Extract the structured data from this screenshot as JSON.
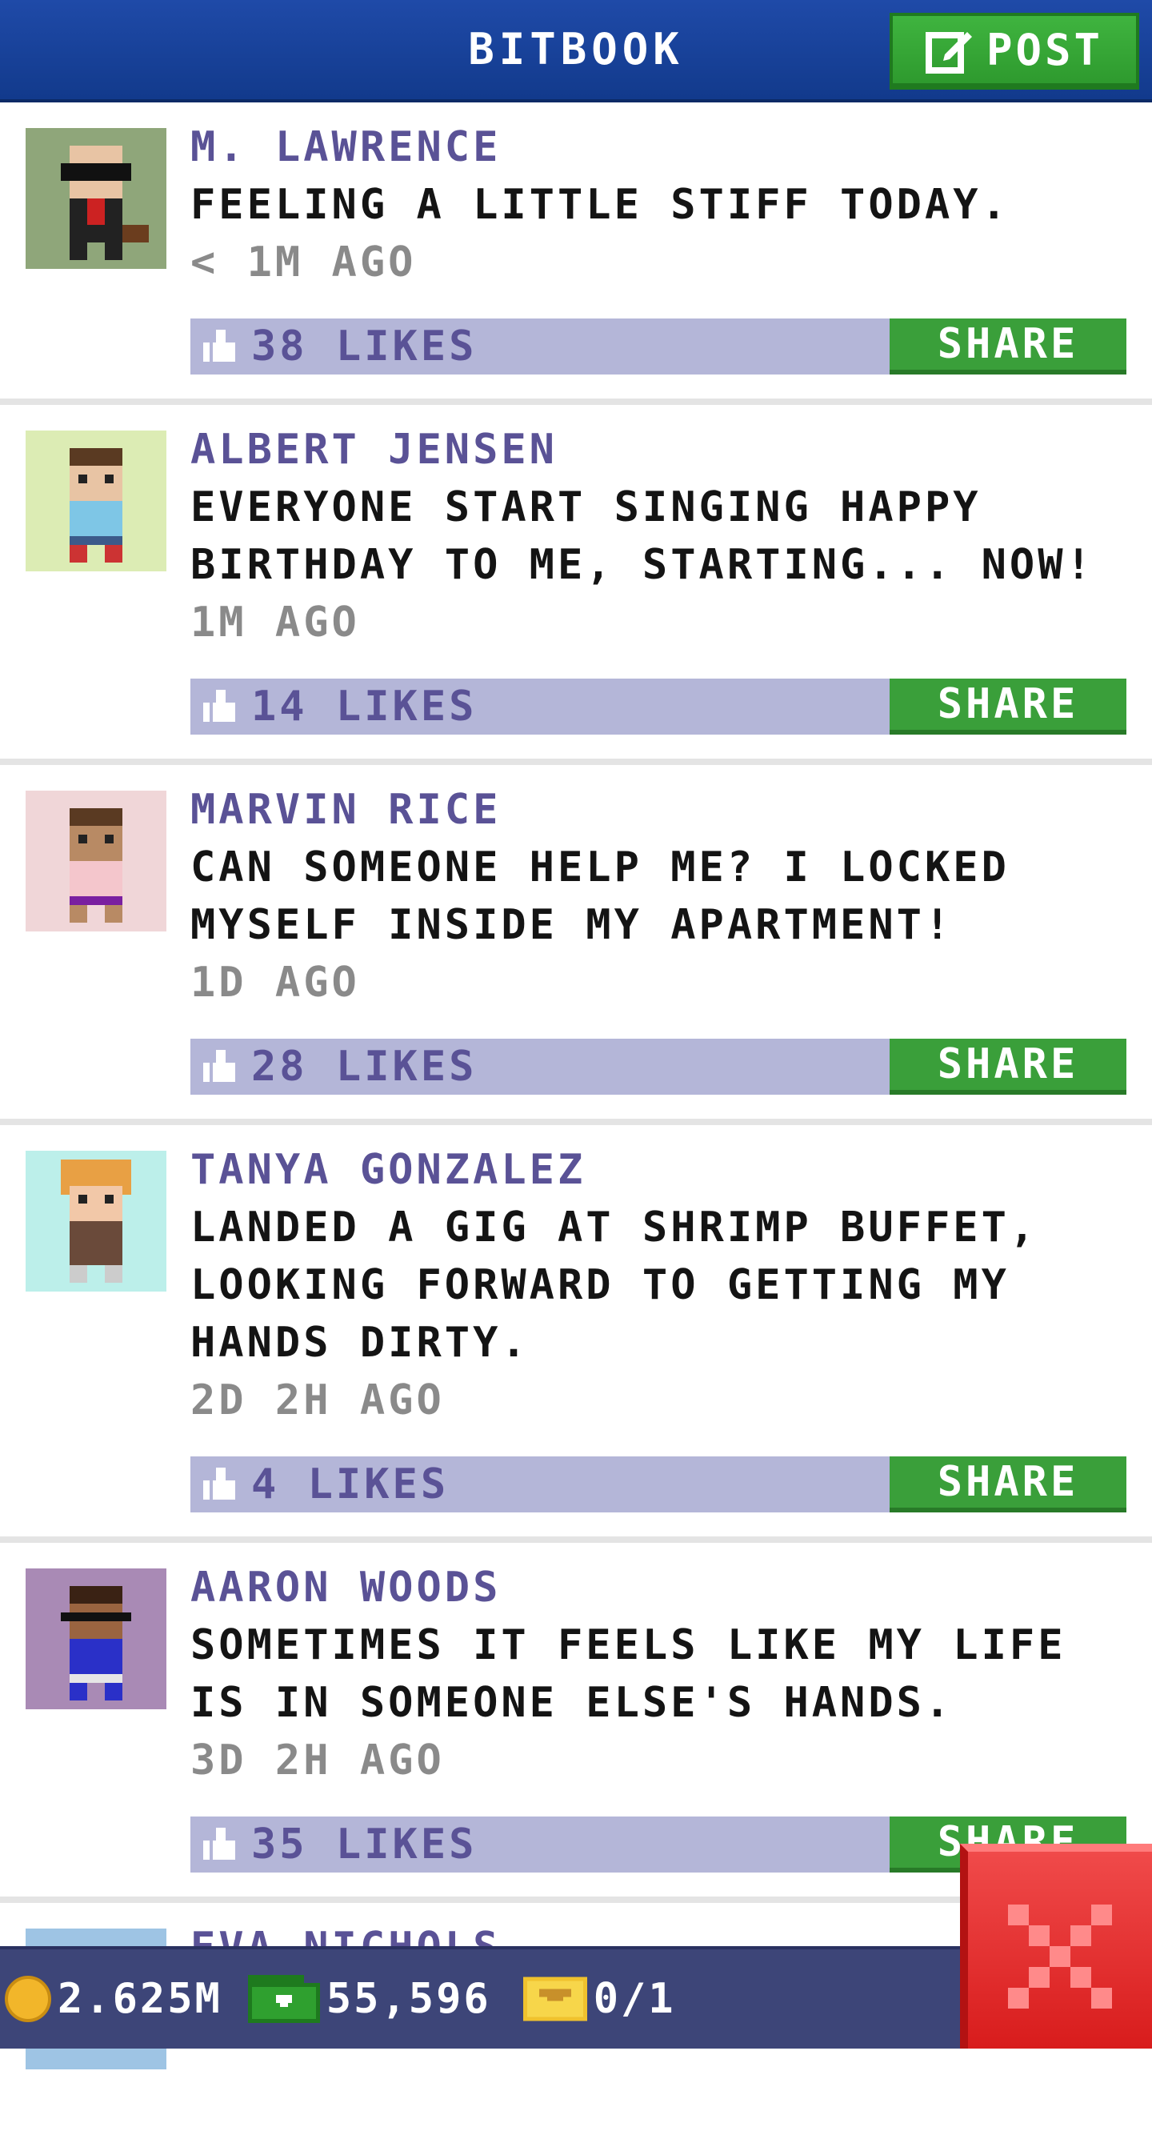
{
  "header": {
    "title": "BITBOOK",
    "post_label": "POST"
  },
  "posts": [
    {
      "author": "M. LAWRENCE",
      "text": "FEELING A LITTLE STIFF TODAY.",
      "time": "< 1M AGO",
      "likes": "38 LIKES",
      "share": "SHARE",
      "avatar_bg": "#8fa67a"
    },
    {
      "author": "ALBERT JENSEN",
      "text": "EVERYONE START SINGING HAPPY BIRTHDAY TO ME, STARTING... NOW!",
      "time": "1M AGO",
      "likes": "14 LIKES",
      "share": "SHARE",
      "avatar_bg": "#dcecb4"
    },
    {
      "author": "MARVIN RICE",
      "text": "CAN SOMEONE HELP ME? I LOCKED MYSELF INSIDE MY APARTMENT!",
      "time": "1D AGO",
      "likes": "28 LIKES",
      "share": "SHARE",
      "avatar_bg": "#f0d6d8"
    },
    {
      "author": "TANYA GONZALEZ",
      "text": "LANDED A GIG AT SHRIMP BUFFET, LOOKING FORWARD TO GETTING MY HANDS DIRTY.",
      "time": "2D 2H AGO",
      "likes": "4 LIKES",
      "share": "SHARE",
      "avatar_bg": "#bcefea"
    },
    {
      "author": "AARON WOODS",
      "text": "SOMETIMES IT FEELS LIKE MY LIFE IS IN SOMEONE ELSE'S HANDS.",
      "time": "3D 2H AGO",
      "likes": "35 LIKES",
      "share": "SHARE",
      "avatar_bg": "#a98ab5"
    },
    {
      "author": "EVA NICHOLS",
      "avatar_bg": "#9ec4e4"
    }
  ],
  "statusbar": {
    "coins": "2.625M",
    "bux": "55,596",
    "tickets": "0/1"
  },
  "colors": {
    "header": "#1f4aa8",
    "share": "#3a9f3a",
    "likes_bar": "#b4b6d8",
    "close": "#e02a2a"
  }
}
